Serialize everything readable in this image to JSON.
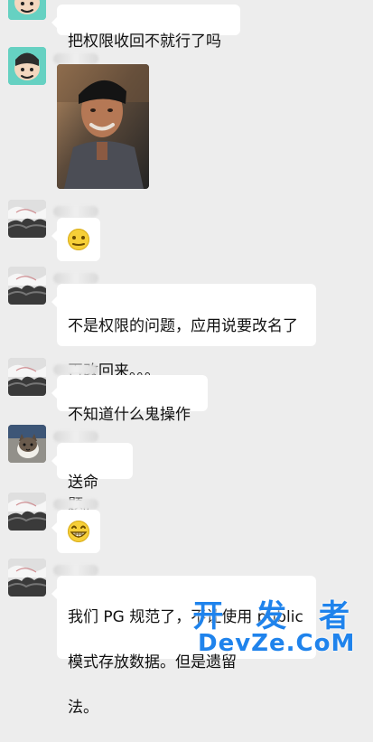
{
  "watermark": {
    "top": "开 发 者",
    "bottom": "DevZe.CoM"
  },
  "messages": [
    {
      "id": "message-1",
      "avatar_icon": "cartoon-avatar-icon",
      "text": "把权限收回不就行了吗"
    },
    {
      "id": "message-2",
      "avatar_icon": "cartoon-avatar-icon",
      "image_icon": "portrait-photo-icon"
    },
    {
      "id": "message-3",
      "avatar_icon": "user-avatar-icon",
      "emoji_icon": "awkward-smile-emoji-icon"
    },
    {
      "id": "message-4",
      "avatar_icon": "user-avatar-icon",
      "text_lines": [
        "不是权限的问题，应用说要改名了",
        "再改回来。。。"
      ]
    },
    {
      "id": "message-5",
      "avatar_icon": "user-avatar-icon",
      "text": "不知道什么鬼操作"
    },
    {
      "id": "message-6",
      "avatar_icon": "cat-avatar-icon",
      "text": "送命题。"
    },
    {
      "id": "message-7",
      "avatar_icon": "user-avatar-icon",
      "emoji_icon": "grin-emoji-icon"
    },
    {
      "id": "message-8",
      "avatar_icon": "user-avatar-icon",
      "text_lines": [
        "我们 PG 规范了，不让使用 public",
        "模式存放数据。但是遗留",
        "法。"
      ]
    }
  ]
}
